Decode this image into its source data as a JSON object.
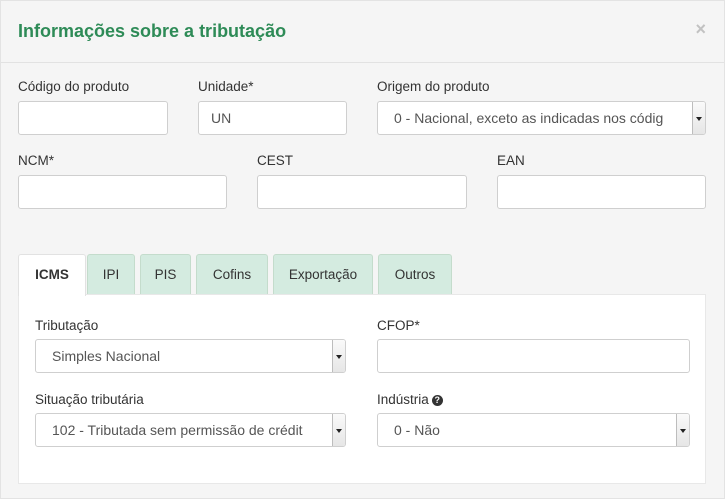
{
  "modal": {
    "title": "Informações sobre a tributação",
    "close_label": "×"
  },
  "form": {
    "codigo": {
      "label": "Código do produto",
      "value": ""
    },
    "unidade": {
      "label": "Unidade*",
      "value": "UN"
    },
    "origem": {
      "label": "Origem do produto",
      "value": "0 - Nacional, exceto as indicadas nos códig"
    },
    "ncm": {
      "label": "NCM*",
      "value": ""
    },
    "cest": {
      "label": "CEST",
      "value": ""
    },
    "ean": {
      "label": "EAN",
      "value": ""
    }
  },
  "tabs": [
    {
      "label": "ICMS",
      "active": true
    },
    {
      "label": "IPI"
    },
    {
      "label": "PIS"
    },
    {
      "label": "Cofins"
    },
    {
      "label": "Exportação"
    },
    {
      "label": "Outros"
    }
  ],
  "icms": {
    "tributacao": {
      "label": "Tributação",
      "value": "Simples Nacional"
    },
    "cfop": {
      "label": "CFOP*",
      "value": ""
    },
    "situacao": {
      "label": "Situação tributária",
      "value": "102 - Tributada sem permissão de crédit"
    },
    "industria": {
      "label": "Indústria",
      "help_icon": "question-circle-icon",
      "value": "0 - Não"
    }
  }
}
